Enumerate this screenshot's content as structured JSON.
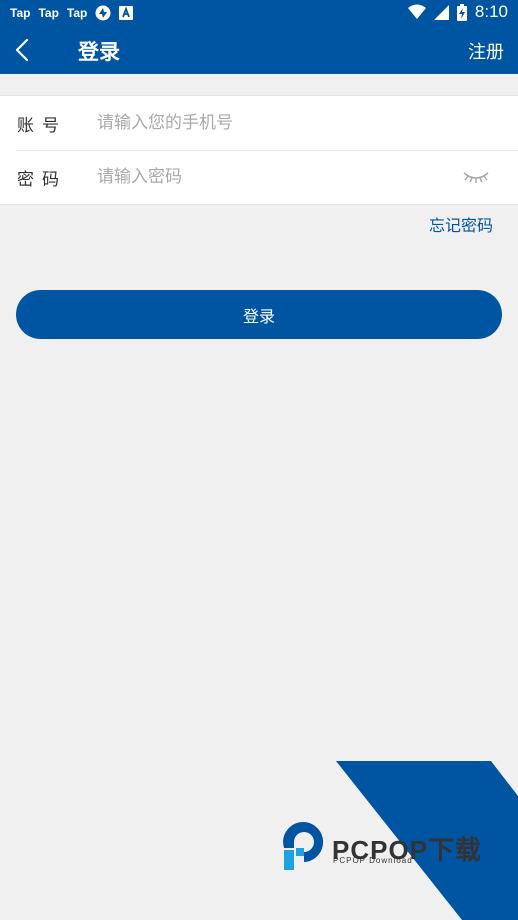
{
  "status_bar": {
    "notifications": [
      "Tap",
      "Tap",
      "Tap"
    ],
    "time": "8:10"
  },
  "header": {
    "title": "登录",
    "register_label": "注册"
  },
  "form": {
    "account_label": "账号",
    "account_placeholder": "请输入您的手机号",
    "password_label": "密码",
    "password_placeholder": "请输入密码"
  },
  "forgot_password_label": "忘记密码",
  "login_button_label": "登录",
  "watermark": {
    "name": "PCPOP下载",
    "subtitle": "PCPOP Download"
  },
  "colors": {
    "primary": "#0055a3",
    "background": "#f0f0f1",
    "watermark_accent": "#1fa3e0"
  },
  "icons": [
    "back-arrow-icon",
    "eye-closed-icon",
    "wifi-icon",
    "signal-icon",
    "battery-icon",
    "sync-icon",
    "a-badge-icon"
  ]
}
